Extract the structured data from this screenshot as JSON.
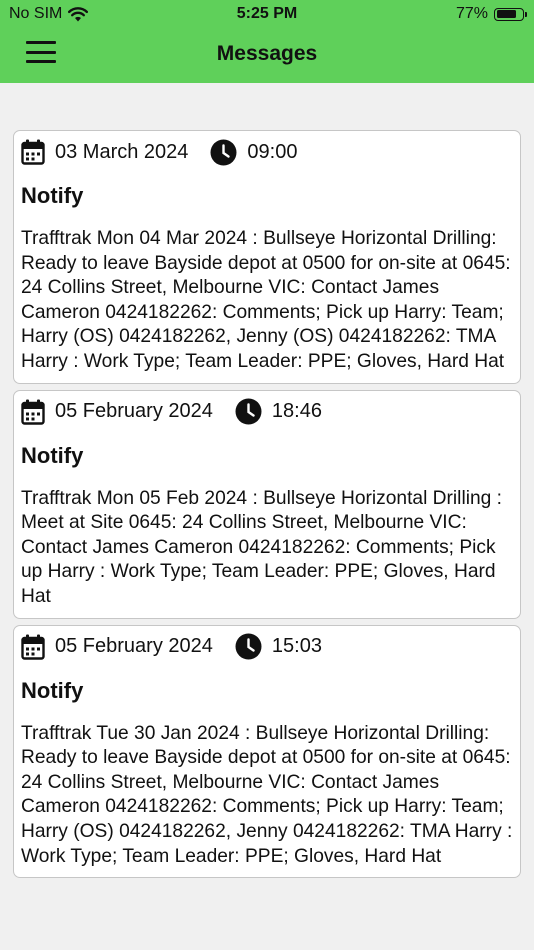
{
  "status_bar": {
    "carrier": "No SIM",
    "time": "5:25 PM",
    "battery": "77%",
    "battery_level": 0.77
  },
  "header": {
    "title": "Messages",
    "menu_icon": "hamburger-menu-icon"
  },
  "messages": [
    {
      "date": "03 March 2024",
      "time": "09:00",
      "title": "Notify",
      "body": "Trafftrak Mon 04 Mar 2024 : Bullseye Horizontal Drilling: Ready to leave Bayside depot at 0500 for on-site at 0645: 24 Collins Street, Melbourne VIC: Contact James Cameron 0424182262: Comments; Pick up Harry: Team; Harry (OS) 0424182262, Jenny (OS) 0424182262: TMA Harry : Work Type; Team Leader: PPE; Gloves, Hard Hat"
    },
    {
      "date": "05 February 2024",
      "time": "18:46",
      "title": "Notify",
      "body": "Trafftrak Mon 05 Feb 2024 : Bullseye Horizontal Drilling : Meet at Site 0645: 24 Collins Street, Melbourne VIC: Contact James Cameron 0424182262: Comments; Pick up Harry : Work Type; Team Leader: PPE; Gloves, Hard Hat"
    },
    {
      "date": "05 February 2024",
      "time": "15:03",
      "title": "Notify",
      "body": "Trafftrak Tue 30 Jan 2024 : Bullseye Horizontal Drilling: Ready to leave Bayside depot at 0500 for on-site at 0645: 24 Collins Street, Melbourne VIC: Contact James Cameron 0424182262: Comments; Pick up Harry: Team; Harry (OS) 0424182262, Jenny 0424182262: TMA Harry : Work Type; Team Leader: PPE; Gloves, Hard Hat"
    }
  ]
}
